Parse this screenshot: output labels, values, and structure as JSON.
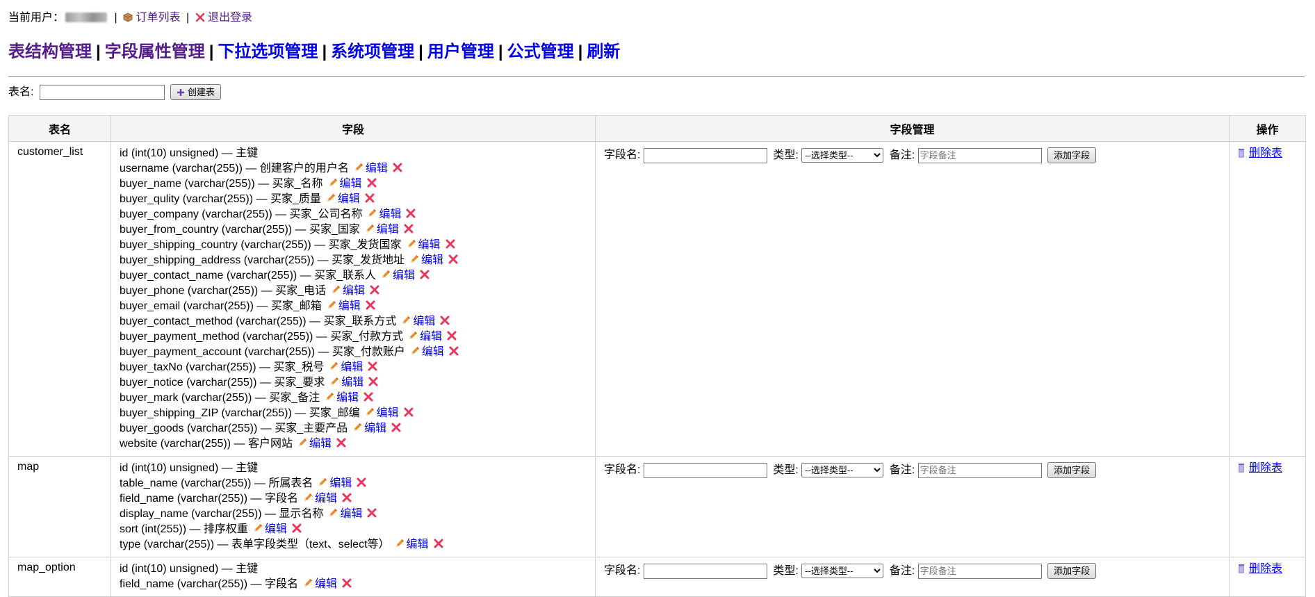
{
  "topbar": {
    "current_user_label": "当前用户：",
    "separator": "|",
    "orders_label": "订单列表",
    "logout_label": "退出登录"
  },
  "nav": {
    "items": [
      "表结构管理",
      "字段属性管理",
      "下拉选项管理",
      "系统项管理",
      "用户管理",
      "公式管理",
      "刷新"
    ],
    "separator": "|"
  },
  "create": {
    "label": "表名:",
    "input_value": "",
    "button_label": "创建表"
  },
  "table": {
    "headers": [
      "表名",
      "字段",
      "字段管理",
      "操作"
    ],
    "field_management": {
      "field_name_label": "字段名:",
      "type_label": "类型:",
      "type_selected": "--选择类型--",
      "note_label": "备注:",
      "note_placeholder": "字段备注",
      "add_button": "添加字段"
    },
    "edit_label": "编辑",
    "delete_table_label": "删除表",
    "rows": [
      {
        "name": "customer_list",
        "fields": [
          {
            "text": "id (int(10) unsigned) — 主键",
            "actions": false
          },
          {
            "text": "username (varchar(255)) — 创建客户的用户名",
            "actions": true
          },
          {
            "text": "buyer_name (varchar(255)) — 买家_名称",
            "actions": true
          },
          {
            "text": "buyer_qulity (varchar(255)) — 买家_质量",
            "actions": true
          },
          {
            "text": "buyer_company (varchar(255)) — 买家_公司名称",
            "actions": true
          },
          {
            "text": "buyer_from_country (varchar(255)) — 买家_国家",
            "actions": true
          },
          {
            "text": "buyer_shipping_country (varchar(255)) — 买家_发货国家",
            "actions": true
          },
          {
            "text": "buyer_shipping_address (varchar(255)) — 买家_发货地址",
            "actions": true
          },
          {
            "text": "buyer_contact_name (varchar(255)) — 买家_联系人",
            "actions": true
          },
          {
            "text": "buyer_phone (varchar(255)) — 买家_电话",
            "actions": true
          },
          {
            "text": "buyer_email (varchar(255)) — 买家_邮箱",
            "actions": true
          },
          {
            "text": "buyer_contact_method (varchar(255)) — 买家_联系方式",
            "actions": true
          },
          {
            "text": "buyer_payment_method (varchar(255)) — 买家_付款方式",
            "actions": true
          },
          {
            "text": "buyer_payment_account (varchar(255)) — 买家_付款账户",
            "actions": true
          },
          {
            "text": "buyer_taxNo (varchar(255)) — 买家_税号",
            "actions": true
          },
          {
            "text": "buyer_notice (varchar(255)) — 买家_要求",
            "actions": true
          },
          {
            "text": "buyer_mark (varchar(255)) — 买家_备注",
            "actions": true
          },
          {
            "text": "buyer_shipping_ZIP (varchar(255)) — 买家_邮编",
            "actions": true
          },
          {
            "text": "buyer_goods (varchar(255)) — 买家_主要产品",
            "actions": true
          },
          {
            "text": "website (varchar(255)) — 客户网站",
            "actions": true
          }
        ]
      },
      {
        "name": "map",
        "fields": [
          {
            "text": "id (int(10) unsigned) — 主键",
            "actions": false
          },
          {
            "text": "table_name (varchar(255)) — 所属表名",
            "actions": true
          },
          {
            "text": "field_name (varchar(255)) — 字段名",
            "actions": true
          },
          {
            "text": "display_name (varchar(255)) — 显示名称",
            "actions": true
          },
          {
            "text": "sort (int(255)) — 排序权重",
            "actions": true
          },
          {
            "text": "type (varchar(255)) — 表单字段类型（text、select等）",
            "actions": true
          }
        ]
      },
      {
        "name": "map_option",
        "fields": [
          {
            "text": "id (int(10) unsigned) — 主键",
            "actions": false
          },
          {
            "text": "field_name (varchar(255)) — 字段名",
            "actions": true
          }
        ]
      }
    ]
  },
  "colors": {
    "visited_link": "#551a8b",
    "link": "#0000ee",
    "delete_x": "#e8365d",
    "pencil": "#f08a24"
  }
}
